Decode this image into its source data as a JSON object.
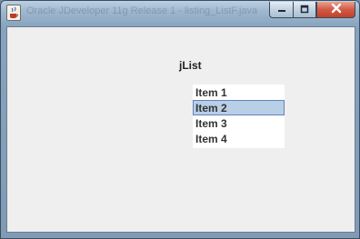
{
  "window": {
    "title": "Oracle JDeveloper 11g Release 1 - listing_ListF.java",
    "icon": "java-cup-icon"
  },
  "controls": {
    "minimize_icon": "minimize-icon",
    "maximize_icon": "maximize-icon",
    "close_icon": "close-icon"
  },
  "content": {
    "label": "jList",
    "items": [
      "Item 1",
      "Item 2",
      "Item 3",
      "Item 4"
    ],
    "selected_item": "Item 2"
  },
  "colors": {
    "selection_bg": "#b8cfe5",
    "selection_border": "#6382bf",
    "close_button": "#c94c36"
  }
}
